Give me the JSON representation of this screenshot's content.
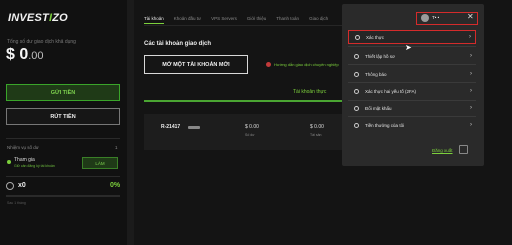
{
  "brand": {
    "logo_main": "INVEST",
    "logo_accent": "I",
    "logo_end": "ZO"
  },
  "sidebar": {
    "balance_label": "Tổng số dư giao dịch khả dụng",
    "balance_int": "$ 0",
    "balance_dec": ".00",
    "deposit_label": "GỬI TIỀN",
    "withdraw_label": "RÚT TIỀN",
    "level_label": "Nhiệm vụ số dư",
    "level_num": "1",
    "join_title": "Tham gia",
    "join_sub": "Giữ cân đăng ký tài khoản",
    "do_label": "LÀM",
    "coin_count": "x0",
    "coin_pct": "0%",
    "progress_fraction": 0.0,
    "footer": "Sau 1 tháng"
  },
  "main": {
    "tabs": [
      "Tài khoản",
      "Khoản đầu tư",
      "VPS Servers",
      "Giới thiệu",
      "Thanh toán",
      "Giao dịch"
    ],
    "section_title": "Các tài khoản giao dịch",
    "open_account": "MỞ MỘT TÀI KHOẢN MỚI",
    "guide_link": "Hướng dẫn giao dịch chuyên nghiệp",
    "subtab": "Tài khoản thực",
    "account": {
      "id": "R-21417",
      "balance": "$ 0.00",
      "balance_label": "Số dư",
      "equity": "$ 0.00",
      "equity_label": "Tài sản"
    }
  },
  "dropdown": {
    "user_name": "T• •",
    "menu": [
      {
        "label": "Xác thực",
        "icon": "check-circle-icon"
      },
      {
        "label": "Thiết lập hồ sơ",
        "icon": "user-settings-icon"
      },
      {
        "label": "Thông báo",
        "icon": "bell-icon"
      },
      {
        "label": "Xác thực hai yếu tố (2FA)",
        "icon": "lock-icon"
      },
      {
        "label": "Đổi mật khẩu",
        "icon": "key-icon"
      },
      {
        "label": "Tiền thưởng của tôi",
        "icon": "gift-icon"
      }
    ],
    "logout_label": "Đăng xuất"
  },
  "colors": {
    "accent": "#7cd03c",
    "highlight": "#d42b2b"
  }
}
